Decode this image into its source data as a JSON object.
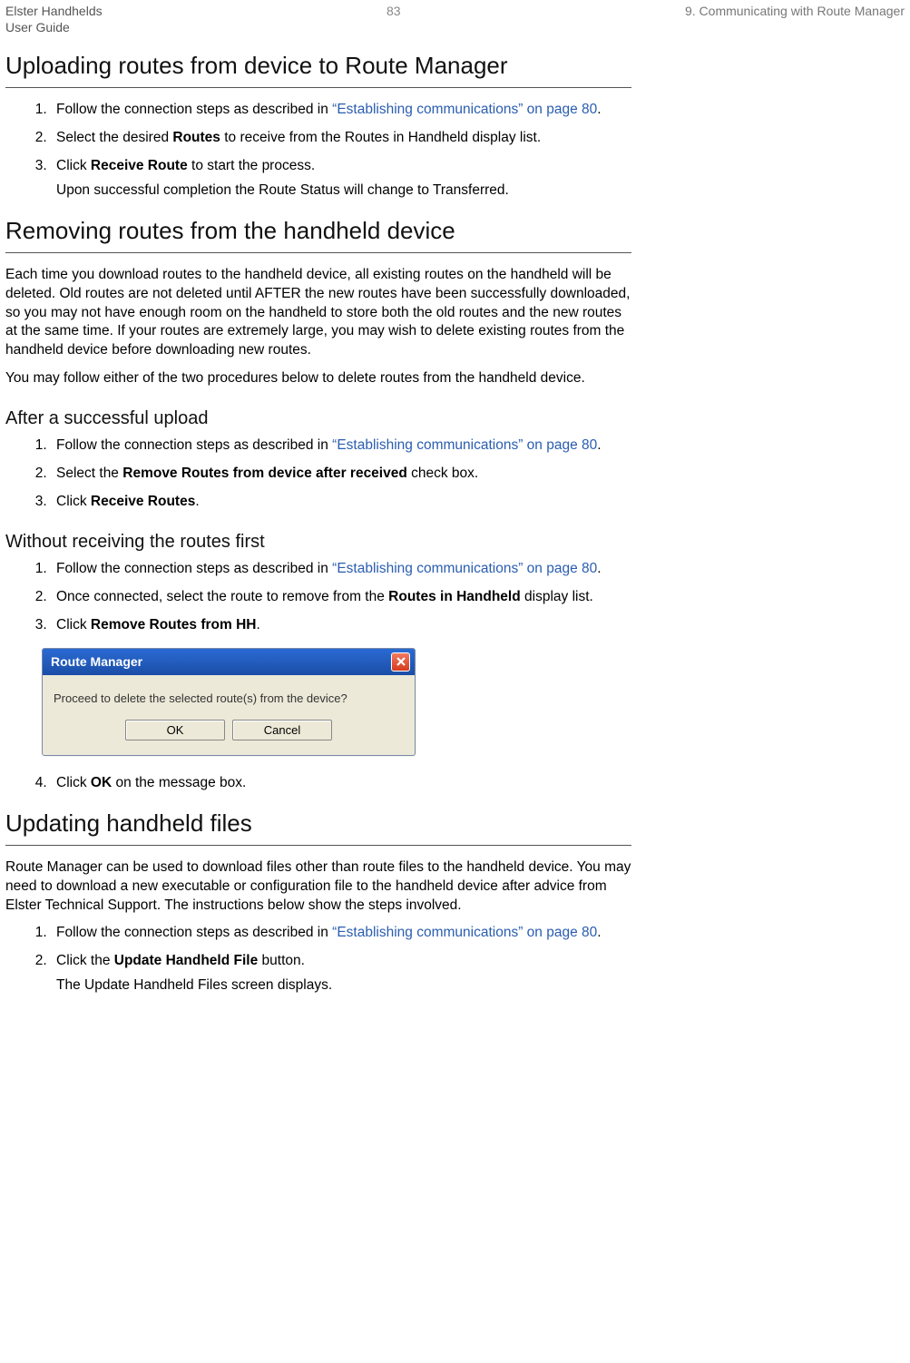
{
  "header": {
    "line1": "Elster Handhelds",
    "line2": "User Guide",
    "page_number": "83",
    "chapter": "9. Communicating with Route Manager"
  },
  "sections": {
    "uploading": {
      "title": "Uploading routes from device to Route Manager",
      "step1_pre": "Follow the connection steps as described in ",
      "step1_link": "“Establishing communications” on page 80",
      "step1_post": ".",
      "step2_pre": "Select the desired ",
      "step2_bold": "Routes",
      "step2_post": " to receive from the Routes in Handheld display list.",
      "step3_pre": "Click ",
      "step3_bold": "Receive Route",
      "step3_post": " to start the process.",
      "step3_sub": "Upon successful completion the Route Status will change to Transferred."
    },
    "removing": {
      "title": "Removing routes from the handheld device",
      "para1": "Each time you download routes to the handheld device, all existing routes on the handheld will be deleted. Old routes are not deleted until AFTER the new routes have been successfully downloaded, so you may not have enough room on the handheld to store both the old routes and the new routes at the same time. If your routes are extremely large, you may wish to delete existing routes from the handheld device before downloading new routes.",
      "para2": "You may follow either of the two procedures below to delete routes from the handheld device.",
      "after_upload": {
        "title": "After a successful upload",
        "step1_pre": "Follow the connection steps as described in ",
        "step1_link": "“Establishing communications” on page 80",
        "step1_post": ".",
        "step2_pre": "Select the ",
        "step2_bold": "Remove Routes from device after received",
        "step2_post": " check box.",
        "step3_pre": "Click ",
        "step3_bold": "Receive Routes",
        "step3_post": "."
      },
      "without_receiving": {
        "title": "Without receiving the routes first",
        "step1_pre": "Follow the connection steps as described in ",
        "step1_link": "“Establishing communications” on page 80",
        "step1_post": ".",
        "step2_pre": "Once connected, select the route to remove from the ",
        "step2_bold": "Routes in Handheld",
        "step2_post": " display list.",
        "step3_pre": "Click ",
        "step3_bold": "Remove Routes from HH",
        "step3_post": ".",
        "step4_pre": "Click ",
        "step4_bold": "OK",
        "step4_post": " on the message box."
      }
    },
    "dialog": {
      "title": "Route Manager",
      "message": "Proceed to delete the selected route(s) from the device?",
      "ok": "OK",
      "cancel": "Cancel"
    },
    "updating": {
      "title": "Updating handheld files",
      "para1": "Route Manager can be used to download files other than route files to the handheld device. You may need to download a new executable or configuration file to the handheld device after advice from Elster Technical Support. The instructions below show the steps involved.",
      "step1_pre": "Follow the connection steps as described in ",
      "step1_link": "“Establishing communications” on page 80",
      "step1_post": ".",
      "step2_pre": "Click the ",
      "step2_bold": "Update Handheld File",
      "step2_post": " button.",
      "step2_sub": "The Update Handheld Files screen displays."
    }
  }
}
